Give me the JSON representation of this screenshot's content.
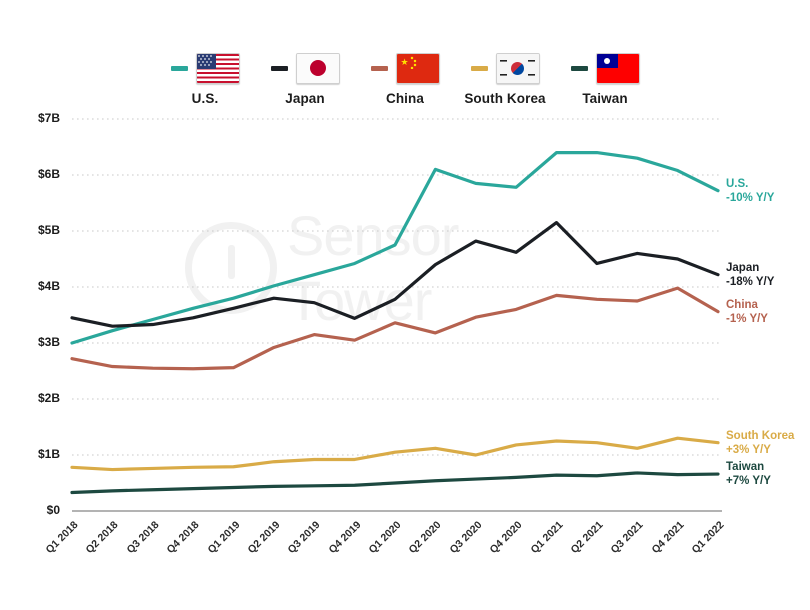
{
  "legend": {
    "items": [
      {
        "label": "U.S.",
        "color": "#2aa79b",
        "flag": "flag-us"
      },
      {
        "label": "Japan",
        "color": "#1b1f24",
        "flag": "flag-jp"
      },
      {
        "label": "China",
        "color": "#b5624f",
        "flag": "flag-cn"
      },
      {
        "label": "South Korea",
        "color": "#d9ab47",
        "flag": "flag-kr"
      },
      {
        "label": "Taiwan",
        "color": "#1d4940",
        "flag": "flag-tw"
      }
    ]
  },
  "watermark": {
    "text": "Sensor Tower",
    "mark": "sensor-tower-logo"
  },
  "end_labels": [
    {
      "name": "U.S.",
      "delta": "-10% Y/Y",
      "color": "#2aa79b"
    },
    {
      "name": "Japan",
      "delta": "-18% Y/Y",
      "color": "#1b1f24"
    },
    {
      "name": "China",
      "delta": "-1% Y/Y",
      "color": "#b5624f"
    },
    {
      "name": "South Korea",
      "delta": "+3% Y/Y",
      "color": "#d9ab47"
    },
    {
      "name": "Taiwan",
      "delta": "+7% Y/Y",
      "color": "#1d4940"
    }
  ],
  "chart_data": {
    "type": "line",
    "title": "",
    "xlabel": "",
    "ylabel": "",
    "ylim": [
      0,
      7
    ],
    "yunit": "B",
    "ytick_labels": [
      "$0",
      "$1B",
      "$2B",
      "$3B",
      "$4B",
      "$5B",
      "$6B",
      "$7B"
    ],
    "ytick_values": [
      0,
      1,
      2,
      3,
      4,
      5,
      6,
      7
    ],
    "grid": true,
    "legend_position": "top",
    "categories": [
      "Q1 2018",
      "Q2 2018",
      "Q3 2018",
      "Q4 2018",
      "Q1 2019",
      "Q2 2019",
      "Q3 2019",
      "Q4 2019",
      "Q1 2020",
      "Q2 2020",
      "Q3 2020",
      "Q4 2020",
      "Q1 2021",
      "Q2 2021",
      "Q3 2021",
      "Q4 2021",
      "Q1 2022"
    ],
    "series": [
      {
        "name": "U.S.",
        "color": "#2aa79b",
        "values": [
          3.0,
          3.22,
          3.42,
          3.62,
          3.8,
          4.02,
          4.22,
          4.42,
          4.75,
          6.1,
          5.85,
          5.78,
          6.4,
          6.4,
          6.3,
          6.08,
          5.72
        ]
      },
      {
        "name": "Japan",
        "color": "#1b1f24",
        "values": [
          3.45,
          3.3,
          3.33,
          3.45,
          3.62,
          3.8,
          3.72,
          3.44,
          3.78,
          4.4,
          4.82,
          4.62,
          5.15,
          4.42,
          4.6,
          4.5,
          4.22
        ]
      },
      {
        "name": "China",
        "color": "#b5624f",
        "values": [
          2.72,
          2.58,
          2.55,
          2.54,
          2.56,
          2.92,
          3.15,
          3.05,
          3.36,
          3.18,
          3.46,
          3.6,
          3.85,
          3.78,
          3.75,
          3.98,
          3.56,
          3.88
        ]
      },
      {
        "name": "South Korea",
        "color": "#d9ab47",
        "values": [
          0.78,
          0.74,
          0.76,
          0.78,
          0.79,
          0.88,
          0.92,
          0.92,
          1.05,
          1.12,
          1.0,
          1.18,
          1.25,
          1.22,
          1.12,
          1.3,
          1.22,
          1.24
        ]
      },
      {
        "name": "Taiwan",
        "color": "#1d4940",
        "values": [
          0.33,
          0.36,
          0.38,
          0.4,
          0.42,
          0.44,
          0.45,
          0.46,
          0.5,
          0.54,
          0.57,
          0.6,
          0.64,
          0.63,
          0.68,
          0.65,
          0.66,
          0.67
        ]
      }
    ]
  }
}
